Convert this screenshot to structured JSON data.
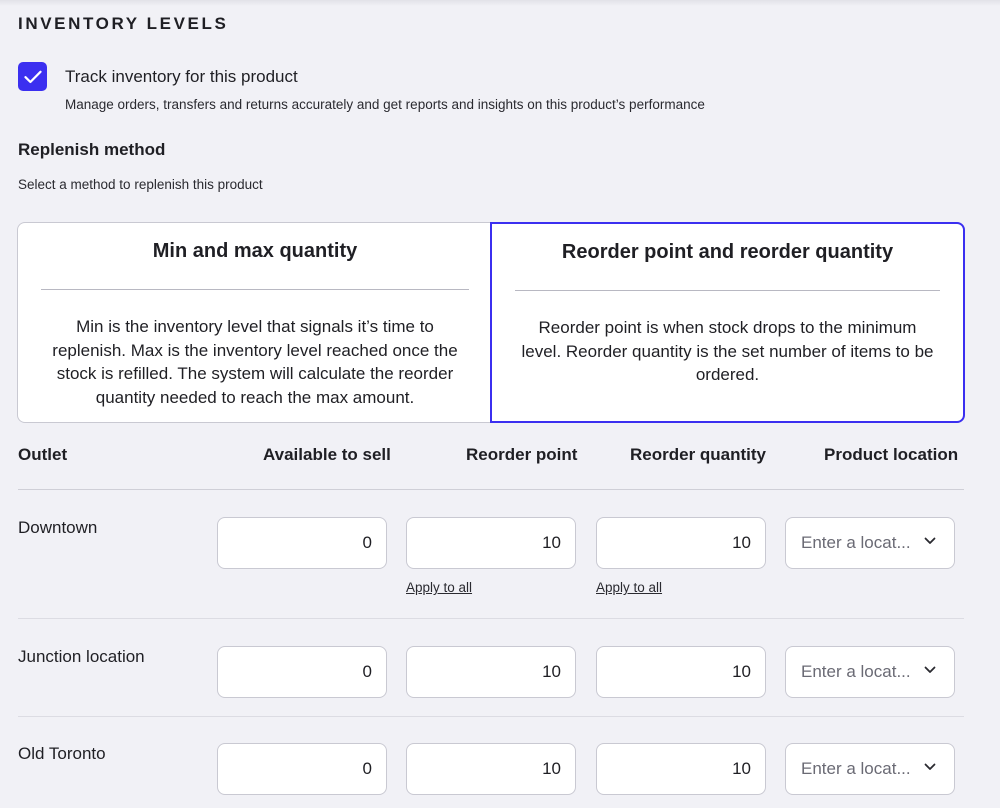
{
  "section": {
    "title": "INVENTORY LEVELS"
  },
  "track": {
    "checked": true,
    "label": "Track inventory for this product",
    "description": "Manage orders, transfers and returns accurately and get reports and insights on this product’s performance"
  },
  "replenish": {
    "title": "Replenish method",
    "description": "Select a method to replenish this product",
    "options": [
      {
        "title": "Min and max quantity",
        "body": "Min is the inventory level that signals it’s time to replenish. Max is the inventory level reached once the stock is refilled. The system will calculate the reorder quantity needed to reach the max amount.",
        "selected": false
      },
      {
        "title": "Reorder point and reorder quantity",
        "body": "Reorder point is when stock drops to the minimum level. Reorder quantity is the set number of items to be ordered.",
        "selected": true
      }
    ]
  },
  "table": {
    "headers": {
      "outlet": "Outlet",
      "available": "Available to sell",
      "reorder_point": "Reorder point",
      "reorder_quantity": "Reorder quantity",
      "location": "Product location"
    },
    "apply_label": "Apply to all",
    "location_placeholder": "Enter a locat...",
    "rows": [
      {
        "outlet": "Downtown",
        "available": "0",
        "reorder_point": "10",
        "reorder_quantity": "10"
      },
      {
        "outlet": "Junction location",
        "available": "0",
        "reorder_point": "10",
        "reorder_quantity": "10"
      },
      {
        "outlet": "Old Toronto",
        "available": "0",
        "reorder_point": "10",
        "reorder_quantity": "10"
      }
    ]
  },
  "colors": {
    "accent": "#3b2ff0",
    "background": "#f1f1f6"
  },
  "icons": {
    "checkbox": "checkmark-icon",
    "select": "chevron-down-icon"
  }
}
